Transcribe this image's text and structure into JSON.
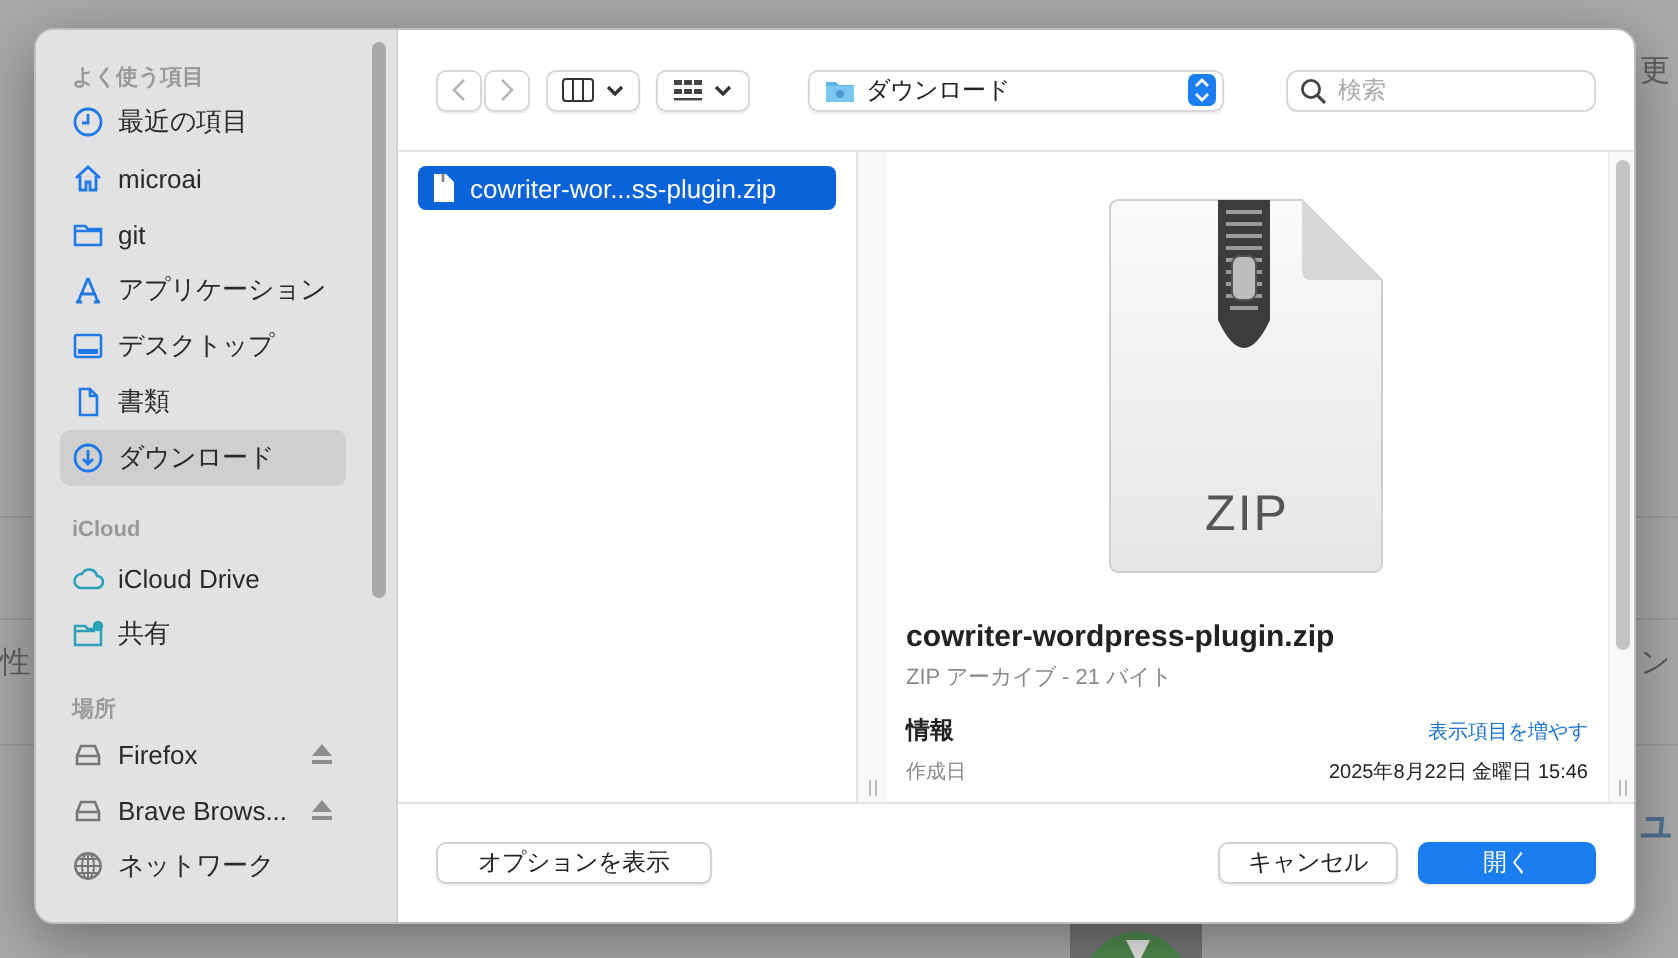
{
  "background": {
    "fragments": [
      {
        "text": "更",
        "kind": "plain"
      },
      {
        "text": "性",
        "kind": "plain"
      },
      {
        "text": "ン",
        "kind": "plain"
      },
      {
        "text": "ュ",
        "kind": "heading"
      }
    ]
  },
  "sidebar": {
    "sections": [
      {
        "title": "よく使う項目",
        "items": [
          {
            "label": "最近の項目",
            "kind": "clock",
            "selected": false,
            "ejectable": false
          },
          {
            "label": "microai",
            "kind": "home",
            "selected": false,
            "ejectable": false
          },
          {
            "label": "git",
            "kind": "folder",
            "selected": false,
            "ejectable": false
          },
          {
            "label": "アプリケーション",
            "kind": "apps",
            "selected": false,
            "ejectable": false
          },
          {
            "label": "デスクトップ",
            "kind": "desktop",
            "selected": false,
            "ejectable": false
          },
          {
            "label": "書類",
            "kind": "document",
            "selected": false,
            "ejectable": false
          },
          {
            "label": "ダウンロード",
            "kind": "download",
            "selected": true,
            "ejectable": false
          }
        ]
      },
      {
        "title": "iCloud",
        "items": [
          {
            "label": "iCloud Drive",
            "kind": "cloud",
            "selected": false,
            "ejectable": false
          },
          {
            "label": "共有",
            "kind": "shared",
            "selected": false,
            "ejectable": false
          }
        ]
      },
      {
        "title": "場所",
        "items": [
          {
            "label": "Firefox",
            "kind": "drive",
            "selected": false,
            "ejectable": true
          },
          {
            "label": "Brave Brows...",
            "kind": "drive",
            "selected": false,
            "ejectable": true
          },
          {
            "label": "ネットワーク",
            "kind": "globe",
            "selected": false,
            "ejectable": false
          }
        ]
      }
    ]
  },
  "toolbar": {
    "location": "ダウンロード",
    "search": {
      "placeholder": "検索"
    }
  },
  "browser": {
    "files": [
      {
        "name": "cowriter-wor...ss-plugin.zip",
        "selected": true
      }
    ]
  },
  "preview": {
    "icon_label": "ZIP",
    "file_name": "cowriter-wordpress-plugin.zip",
    "subtitle": "ZIP アーカイブ - 21 バイト",
    "info_title": "情報",
    "more_link": "表示項目を増やす",
    "fields": [
      {
        "label": "作成日",
        "value": "2025年8月22日 金曜日 15:46"
      }
    ]
  },
  "footer": {
    "options_button": "オプションを表示",
    "cancel_button": "キャンセル",
    "open_button": "開く"
  }
}
